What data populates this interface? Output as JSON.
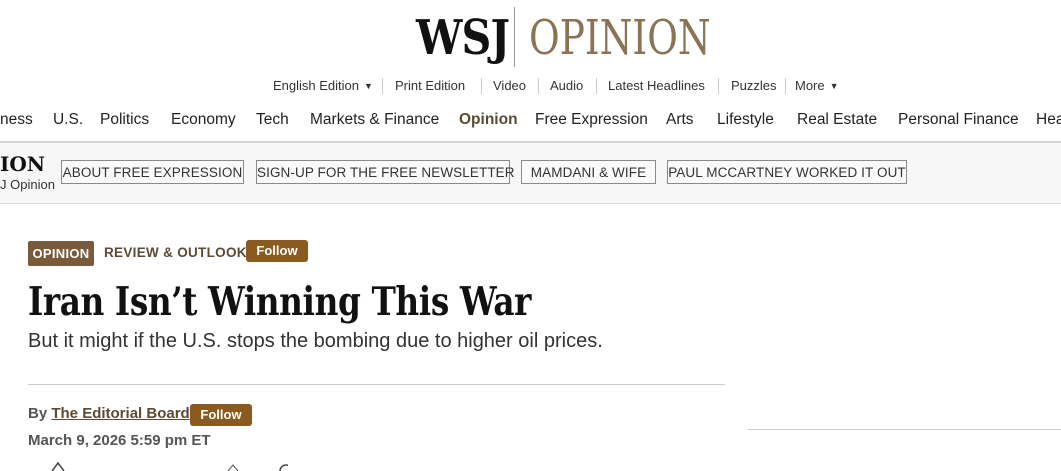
{
  "masthead": {
    "brand": "WSJ",
    "section": "OPINION"
  },
  "utility_nav": {
    "items": [
      {
        "label": "English Edition",
        "has_caret": true
      },
      {
        "label": "Print Edition"
      },
      {
        "label": "Video"
      },
      {
        "label": "Audio"
      },
      {
        "label": "Latest Headlines"
      },
      {
        "label": "Puzzles"
      },
      {
        "label": "More",
        "has_caret": true
      }
    ],
    "caret_glyph": "▼"
  },
  "main_nav": {
    "items": [
      {
        "label": "ness"
      },
      {
        "label": "U.S."
      },
      {
        "label": "Politics"
      },
      {
        "label": "Economy"
      },
      {
        "label": "Tech"
      },
      {
        "label": "Markets & Finance"
      },
      {
        "label": "Opinion",
        "active": true
      },
      {
        "label": "Free Expression"
      },
      {
        "label": "Arts"
      },
      {
        "label": "Lifestyle"
      },
      {
        "label": "Real Estate"
      },
      {
        "label": "Personal Finance"
      },
      {
        "label": "Hea"
      }
    ]
  },
  "section_bar": {
    "label_big": "ION",
    "label_small": "J Opinion",
    "pills": [
      {
        "label": "ABOUT FREE EXPRESSION"
      },
      {
        "label": "SIGN-UP FOR THE FREE NEWSLETTER"
      },
      {
        "label": "MAMDANI & WIFE"
      },
      {
        "label": "PAUL MCCARTNEY WORKED IT OUT"
      }
    ]
  },
  "article": {
    "tag": "OPINION",
    "column": "REVIEW & OUTLOOK",
    "follow_label": "Follow",
    "headline": "Iran Isn’t Winning This War",
    "dek": "But it might if the U.S. stops the bombing due to higher oil prices.",
    "byline_prefix": "By",
    "author": "The Editorial Board",
    "author_follow_label": "Follow",
    "date": "March 9, 2026 5:59 pm ET"
  },
  "colors": {
    "opinion_brown": "#8b7355",
    "tag_bg": "#7a5a3a",
    "follow_bg": "#8a5a1f",
    "active_nav": "#5c4a33",
    "section_bar_bg": "#f7f7f7"
  }
}
